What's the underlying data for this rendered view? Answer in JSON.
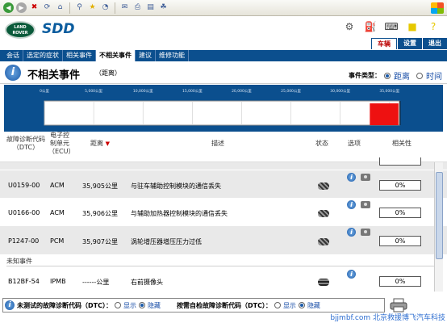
{
  "header": {
    "tabs": [
      {
        "label": "车辆"
      },
      {
        "label": "设置"
      },
      {
        "label": "退出"
      }
    ]
  },
  "nav": {
    "tabs": [
      {
        "label": "会话"
      },
      {
        "label": "选定的症状"
      },
      {
        "label": "相关事件"
      },
      {
        "label": "不相关事件"
      },
      {
        "label": "建议"
      },
      {
        "label": "维修功能"
      }
    ]
  },
  "page": {
    "title": "不相关事件",
    "subtitle": "（距离）",
    "event_type_label": "事件类型：",
    "event_type_options": [
      {
        "label": "距离"
      },
      {
        "label": "时间"
      }
    ],
    "event_type_selected": "距离"
  },
  "chart_data": {
    "type": "bar",
    "tick_labels": [
      "0公里",
      "5,000公里",
      "10,000公里",
      "15,000公里",
      "20,000公里",
      "25,000公里",
      "30,000公里",
      "35,000公里"
    ],
    "x_max": 36000,
    "events_km": [
      35905,
      35906,
      35907
    ],
    "bar_color": "#ee1111"
  },
  "columns": {
    "dtc": [
      "故障诊断代码",
      "（DTC）"
    ],
    "ecu": [
      "电子控",
      "制单元",
      "（ECU）"
    ],
    "distance": "距离",
    "description": "描述",
    "state": "状态",
    "options": "选项",
    "relevance": "相关性"
  },
  "rows": [
    {
      "dtc": "U0159-00",
      "ecu": "ACM",
      "distance": "35,905公里",
      "description": "与驻车辅助控制模块的通信丢失",
      "relevance": "0%"
    },
    {
      "dtc": "U0166-00",
      "ecu": "ACM",
      "distance": "35,906公里",
      "description": "与辅助加热器控制模块的通信丢失",
      "relevance": "0%"
    },
    {
      "dtc": "P1247-00",
      "ecu": "PCM",
      "distance": "35,907公里",
      "description": "涡轮增压器增压压力过低",
      "relevance": "0%"
    }
  ],
  "unknown_section": {
    "title": "未知事件",
    "rows": [
      {
        "dtc": "B12BF-54",
        "ecu": "IPMB",
        "distance": "------公里",
        "description": "右前摄像头",
        "relevance": "0%"
      }
    ]
  },
  "footer": {
    "untested_label": "未测试的故障诊断代码（DTC）：",
    "checked_label": "按需自检故障诊断代码（DTC）：",
    "show": "显示",
    "hide": "隐藏"
  },
  "watermark": "bjjmbf.com 北京救援博飞汽车科技"
}
